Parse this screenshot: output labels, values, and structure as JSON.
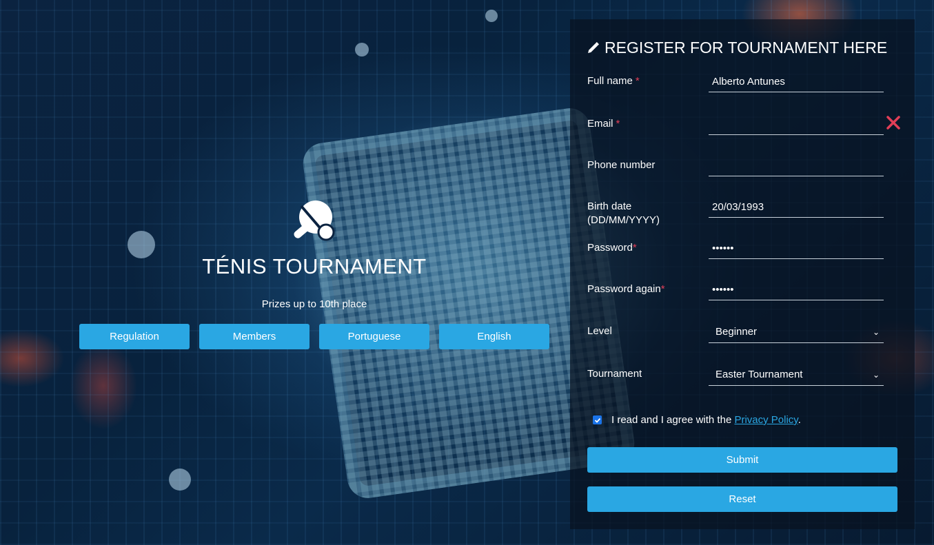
{
  "hero": {
    "icon": "ping-pong-paddle-icon",
    "title": "TÉNIS TOURNAMENT",
    "subtitle": "Prizes up to 10th place",
    "buttons": [
      "Regulation",
      "Members",
      "Portuguese",
      "English"
    ]
  },
  "form": {
    "title": "REGISTER FOR TOURNAMENT HERE",
    "title_icon": "pencil-icon",
    "fields": {
      "full_name": {
        "label": "Full name",
        "required_mark": "*",
        "value": "Alberto Antunes"
      },
      "email": {
        "label": "Email",
        "required_mark": "*",
        "value": "",
        "error_icon": "close-icon"
      },
      "phone": {
        "label": "Phone number",
        "value": ""
      },
      "birth": {
        "label": "Birth date",
        "label_hint": "(DD/MM/YYYY)",
        "value": "20/03/1993"
      },
      "password": {
        "label": "Password",
        "required_mark": "*",
        "value": "••••••"
      },
      "password_again": {
        "label": "Password again",
        "required_mark": "*",
        "value": "••••••"
      },
      "level": {
        "label": "Level",
        "value": "Beginner"
      },
      "tournament": {
        "label": "Tournament",
        "value": "Easter Tournament"
      }
    },
    "agree": {
      "checked": true,
      "text_before": "I read and I agree with the ",
      "link_text": "Privacy Policy",
      "text_after": "."
    },
    "submit_label": "Submit",
    "reset_label": "Reset"
  },
  "colors": {
    "accent": "#2aa7e3",
    "required": "#e23e57",
    "error": "#e23e57"
  }
}
